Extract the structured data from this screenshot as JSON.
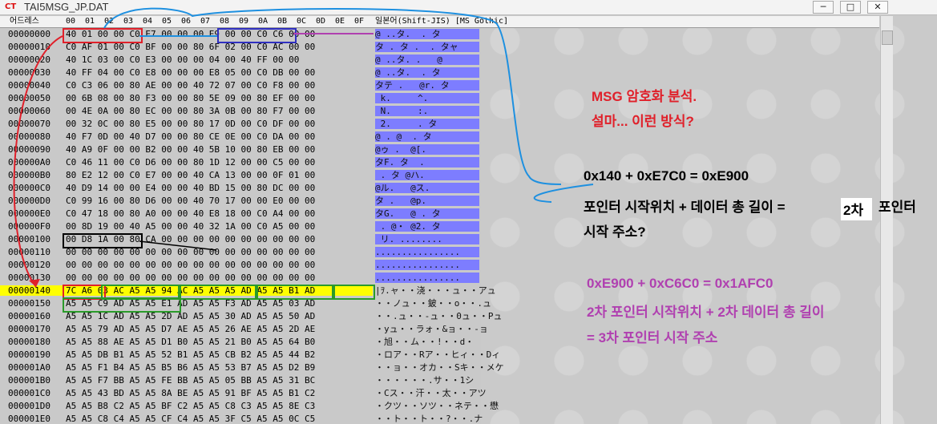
{
  "window": {
    "title": "TAI5MSG_JP.DAT",
    "buttons": [
      "─",
      "□",
      "✕"
    ]
  },
  "columns": {
    "address": "어드레스",
    "hex": [
      "00",
      "01",
      "02",
      "03",
      "04",
      "05",
      "06",
      "07",
      "08",
      "09",
      "0A",
      "0B",
      "0C",
      "0D",
      "0E",
      "0F"
    ],
    "text": "일본어(Shift-JIS) [MS Gothic]"
  },
  "rows": [
    {
      "addr": "00000000",
      "hex": "40 01 00 00 C0 E7 00 00 00 E9 00 00 C0 C6 00 00",
      "ascii": "@ ..タ.  . タ"
    },
    {
      "addr": "00000010",
      "hex": "C0 AF 01 00 C0 BF 00 00 80 6F 02 00 C0 AC 00 00",
      "ascii": "タ . タ .  . タャ"
    },
    {
      "addr": "00000020",
      "hex": "40 1C 03 00 C0 E3 00 00 00 04 00 40 FF 00 00",
      "ascii": "@ ..タ. .   @"
    },
    {
      "addr": "00000030",
      "hex": "40 FF 04 00 C0 E8 00 00 00 E8 05 00 C0 DB 00 00",
      "ascii": "@ ..タ.  . タ"
    },
    {
      "addr": "00000040",
      "c": "",
      "hex": "C0 C3 06 00 80 AE 00 00 40 72 07 00 C0 F8 00 00",
      "ascii": "タテ .   @r. タ"
    },
    {
      "addr": "00000050",
      "hex": "00 6B 08 00 80 F3 00 00 80 5E 09 00 80 EF 00 00",
      "ascii": " k.     ^. "
    },
    {
      "addr": "00000060",
      "hex": "00 4E 0A 00 80 EC 00 00 80 3A 0B 00 80 F7 00 00",
      "ascii": " N.     :. "
    },
    {
      "addr": "00000070",
      "hex": "00 32 0C 00 80 E5 00 00 80 17 0D 00 C0 DF 00 00",
      "ascii": " 2.     . タ"
    },
    {
      "addr": "00000080",
      "hex": "40 F7 0D 00 40 D7 00 00 80 CE 0E 00 C0 DA 00 00",
      "ascii": "@ . @  . タ"
    },
    {
      "addr": "00000090",
      "hex": "40 A9 0F 00 00 B2 00 00 40 5B 10 00 80 EB 00 00",
      "ascii": "@ゥ .  @[. "
    },
    {
      "addr": "000000A0",
      "hex": "C0 46 11 00 C0 D6 00 00 80 1D 12 00 00 C5 00 00",
      "ascii": "タF. タ  . "
    },
    {
      "addr": "000000B0",
      "hex": "80 E2 12 00 C0 E7 00 00 40 CA 13 00 00 0F 01 00",
      "ascii": " . タ @ハ. "
    },
    {
      "addr": "000000C0",
      "hex": "40 D9 14 00 00 E4 00 00 40 BD 15 00 80 DC 00 00",
      "ascii": "@ル.   @ス. "
    },
    {
      "addr": "000000D0",
      "hex": "C0 99 16 00 80 D6 00 00 40 70 17 00 00 E0 00 00",
      "ascii": "タ .   @p. "
    },
    {
      "addr": "000000E0",
      "hex": "C0 47 18 00 80 A0 00 00 40 E8 18 00 C0 A4 00 00",
      "ascii": "タG.   @ . タ"
    },
    {
      "addr": "000000F0",
      "hex": "00 8D 19 00 40 A5 00 00 40 32 1A 00 C0 A5 00 00",
      "ascii": " . @・ @2. タ"
    },
    {
      "addr": "00000100",
      "hex": "00 D8 1A 00 80 CA 00 00 00 00 00 00 00 00 00 00",
      "ascii": " リ. ........"
    },
    {
      "addr": "00000110",
      "hex": "00 00 00 00 00 00 00 00 00 00 00 00 00 00 00 00",
      "ascii": "................"
    },
    {
      "addr": "00000120",
      "hex": "00 00 00 00 00 00 00 00 00 00 00 00 00 00 00 00",
      "ascii": "................"
    },
    {
      "addr": "00000130",
      "hex": "00 00 00 00 00 00 00 00 00 00 00 00 00 00 00 00",
      "ascii": "................"
    },
    {
      "addr": "00000140",
      "hex": "7C A6 03 AC A5 A5 94 AC A5 A5 A5 AD A5 A5 B1 AD",
      "ascii": "|ｦ.ャ・・浇・・・ュ・・アュ"
    },
    {
      "addr": "00000150",
      "hex": "A5 A5 C9 AD A5 A5 E1 AD A5 A5 F3 AD A5 A5 03 AD",
      "ascii": "・・ノュ・・鈹・・o・・.ュ"
    },
    {
      "addr": "00000160",
      "hex": "A5 A5 1C AD A5 A5 2D AD A5 A5 30 AD A5 A5 50 AD",
      "ascii": "・・.ュ・・-ュ・・0ュ・・Pュ"
    },
    {
      "addr": "00000170",
      "hex": "A5 A5 79 AD A5 A5 D7 AE A5 A5 26 AE A5 A5 2D AE",
      "ascii": "・yュ・・ラォ・&ョ・・-ョ"
    },
    {
      "addr": "00000180",
      "hex": "A5 A5 88 AE A5 A5 D1 B0 A5 A5 21 B0 A5 A5 64 B0",
      "ascii": "・旭・・ム・・!・・d・"
    },
    {
      "addr": "00000190",
      "hex": "A5 A5 DB B1 A5 A5 52 B1 A5 A5 CB B2 A5 A5 44 B2",
      "ascii": "・ロア・・Rア・・ヒィ・・Dィ"
    },
    {
      "addr": "000001A0",
      "hex": "A5 A5 F1 B4 A5 A5 B5 B6 A5 A5 53 B7 A5 A5 D2 B9",
      "ascii": "・・ョ・・オカ・・Sキ・・メケ"
    },
    {
      "addr": "000001B0",
      "hex": "A5 A5 F7 BB A5 A5 FE BB A5 A5 05 BB A5 A5 31 BC",
      "ascii": "・・・・・・.サ・・1シ"
    },
    {
      "addr": "000001C0",
      "hex": "A5 A5 43 BD A5 A5 8A BE A5 A5 91 BF A5 A5 B1 C2",
      "ascii": "・Cス・・汗・・太・・アツ"
    },
    {
      "addr": "000001D0",
      "hex": "A5 A5 B8 C2 A5 A5 BF C2 A5 A5 C8 C3 A5 A5 8E C3",
      "ascii": "・クツ・・ソツ・・ネテ・・懋"
    },
    {
      "addr": "000001E0",
      "hex": "A5 A5 C8 C4 A5 A5 CF C4 A5 A5 3F C5 A5 A5 0C C5",
      "ascii": "・・ト・・ト・・?・・.ナ"
    }
  ],
  "annotations": {
    "line1": "MSG 암호화 분석.",
    "line2": "설마... 이런 방식?",
    "eq1": "0x140 + 0xE7C0 = 0xE900",
    "eq1b_prefix": "포인터 시작위치 + 데이터 총 길이 =",
    "eq1b_box": "2차",
    "eq1b_suffix": "포인터",
    "eq1c": "시작 주소?",
    "eq2": "0xE900 + 0xC6C0 = 0x1AFC0",
    "eq2b": "2차 포인터 시작위치 + 2차 데이터 총 길이",
    "eq2c": "= 3차 포인터 시작 주소"
  },
  "colors": {
    "red": "#e0202a",
    "blue": "#1e90e0",
    "purple": "#b040b0",
    "highlight": "#ffff00",
    "ascii_blue": "#7d7dff"
  }
}
